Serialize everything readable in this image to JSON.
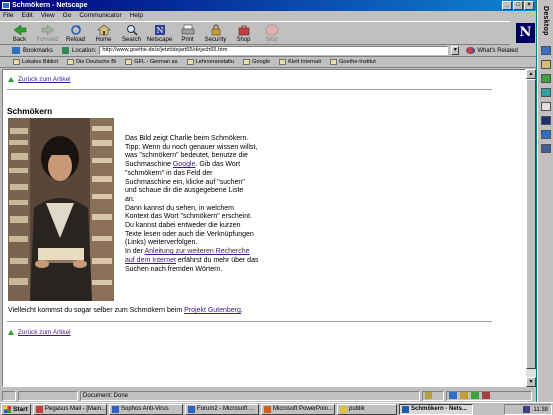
{
  "window": {
    "title": "Schmökern - Netscape"
  },
  "menu": [
    "File",
    "Edit",
    "View",
    "Go",
    "Communicator",
    "Help"
  ],
  "toolbar": {
    "back": "Back",
    "forward": "Forward",
    "reload": "Reload",
    "home": "Home",
    "search": "Search",
    "netscape": "Netscape",
    "print": "Print",
    "security": "Security",
    "shop": "Shop",
    "stop": "Stop"
  },
  "location": {
    "bookmarks_label": "Bookmarks",
    "location_label": "Location:",
    "url": "http://www.goethe.de/z/jetzt/dejart65/dejsch65.htm",
    "related_label": "What's Related"
  },
  "personal_toolbar": [
    "Lokales Bibliot",
    "Die Deutsche Bi",
    "GFL - German as",
    "Lehrveranstaltu",
    "Google",
    "Klett Internati",
    "Goethe-Institut"
  ],
  "page": {
    "back_link_top": "Zurück zum Artikel",
    "heading": "Schmökern",
    "paragraph": {
      "l1": "Das Bild zeigt Charlie beim Schmökern.",
      "l2": "Tipp: Wenn du noch genauer wissen willst,",
      "l3": "was \"schmökern\" bedeutet, benutze die",
      "l4_pre": "Suchmaschine ",
      "l4_link": "Google",
      "l4_post": ". Gib das Wort",
      "l5": "\"schmökern\" in das Feld der",
      "l6": "Suchmaschine ein, klicke auf \"suchen\"",
      "l7": "und schaue dir die ausgegebene Liste",
      "l8": "an.",
      "l9": "Dann kannst du sehen, in welchem",
      "l10": "Kontext das Wort \"schmökern\" erscheint.",
      "l11": "Du kannst dabei entweder die kurzen",
      "l12": "Texte lesen oder auch die Verknüpfungen",
      "l13": "(Links) weiterverfolgen.",
      "l14_pre": "In der ",
      "l14_link": "Anleitung zur weiteren Recherche",
      "l15_link": "auf dem Internet",
      "l15_post": " erfährst du mehr über das",
      "l16": "Suchen nach fremden Wörtern."
    },
    "footer_pre": "Vielleicht kommst du sogar selber zum Schmökern beim ",
    "footer_link": "Projekt Gutenberg",
    "footer_post": ".",
    "back_link_bottom": "Zurück zum Artikel"
  },
  "status": {
    "text": "Document: Done"
  },
  "sidebar": {
    "label": "Desktop"
  },
  "taskbar": {
    "start": "Start",
    "tasks": [
      {
        "label": "Pegasus Mail - [Main...",
        "color": "#c04040"
      },
      {
        "label": "Sophos Anti-Virus",
        "color": "#3060c0"
      },
      {
        "label": "Forum2 - Microsoft ...",
        "color": "#3060c0"
      },
      {
        "label": "Microsoft PowerPoin...",
        "color": "#d06020"
      },
      {
        "label": "publik",
        "color": "#e0c040"
      },
      {
        "label": "Schmökern - Nets...",
        "color": "#2060a0"
      }
    ],
    "clock": "11:38"
  },
  "colors": {
    "titlebar": "#000080",
    "link": "#3a1a8a",
    "chrome": "#c0c0c0",
    "desktop": "#008080"
  }
}
